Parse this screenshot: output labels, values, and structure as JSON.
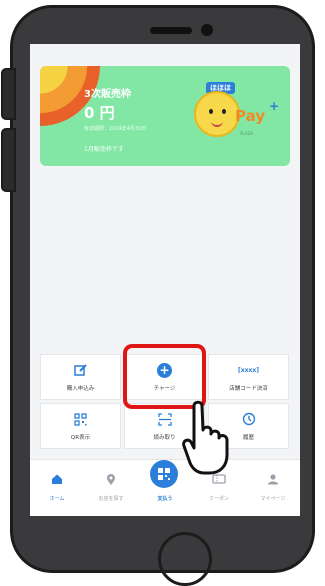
{
  "card": {
    "title": "3次販売枠",
    "amount": "0 円",
    "sub_text": "有効期限：2024年4月30日",
    "note": "1月販売枠です",
    "mascot_tag": "ほほほ",
    "pay_text": "Pay",
    "pay_plus": "+",
    "pay_small": "PLAZA"
  },
  "actions": [
    {
      "label": "購入申込み",
      "icon": "apply-icon"
    },
    {
      "label": "チャージ",
      "icon": "plus-circle-icon"
    },
    {
      "label": "店舗コード決済",
      "icon": "store-code-icon",
      "icon_text": "[xxxx]"
    },
    {
      "label": "QR表示",
      "icon": "qr-icon"
    },
    {
      "label": "読み取り",
      "icon": "scan-icon"
    },
    {
      "label": "履歴",
      "icon": "history-icon"
    }
  ],
  "nav": [
    {
      "label": "ホーム",
      "icon": "home-icon",
      "active": true
    },
    {
      "label": "お店を探す",
      "icon": "map-pin-icon",
      "active": false
    },
    {
      "label": "支払う",
      "icon": "pay-qr-icon",
      "active": true
    },
    {
      "label": "クーポン",
      "icon": "coupon-icon",
      "active": false
    },
    {
      "label": "マイページ",
      "icon": "user-icon",
      "active": false
    }
  ],
  "colors": {
    "accent": "#2b7fd8",
    "card": "#82e6a4",
    "highlight": "#e01515"
  }
}
